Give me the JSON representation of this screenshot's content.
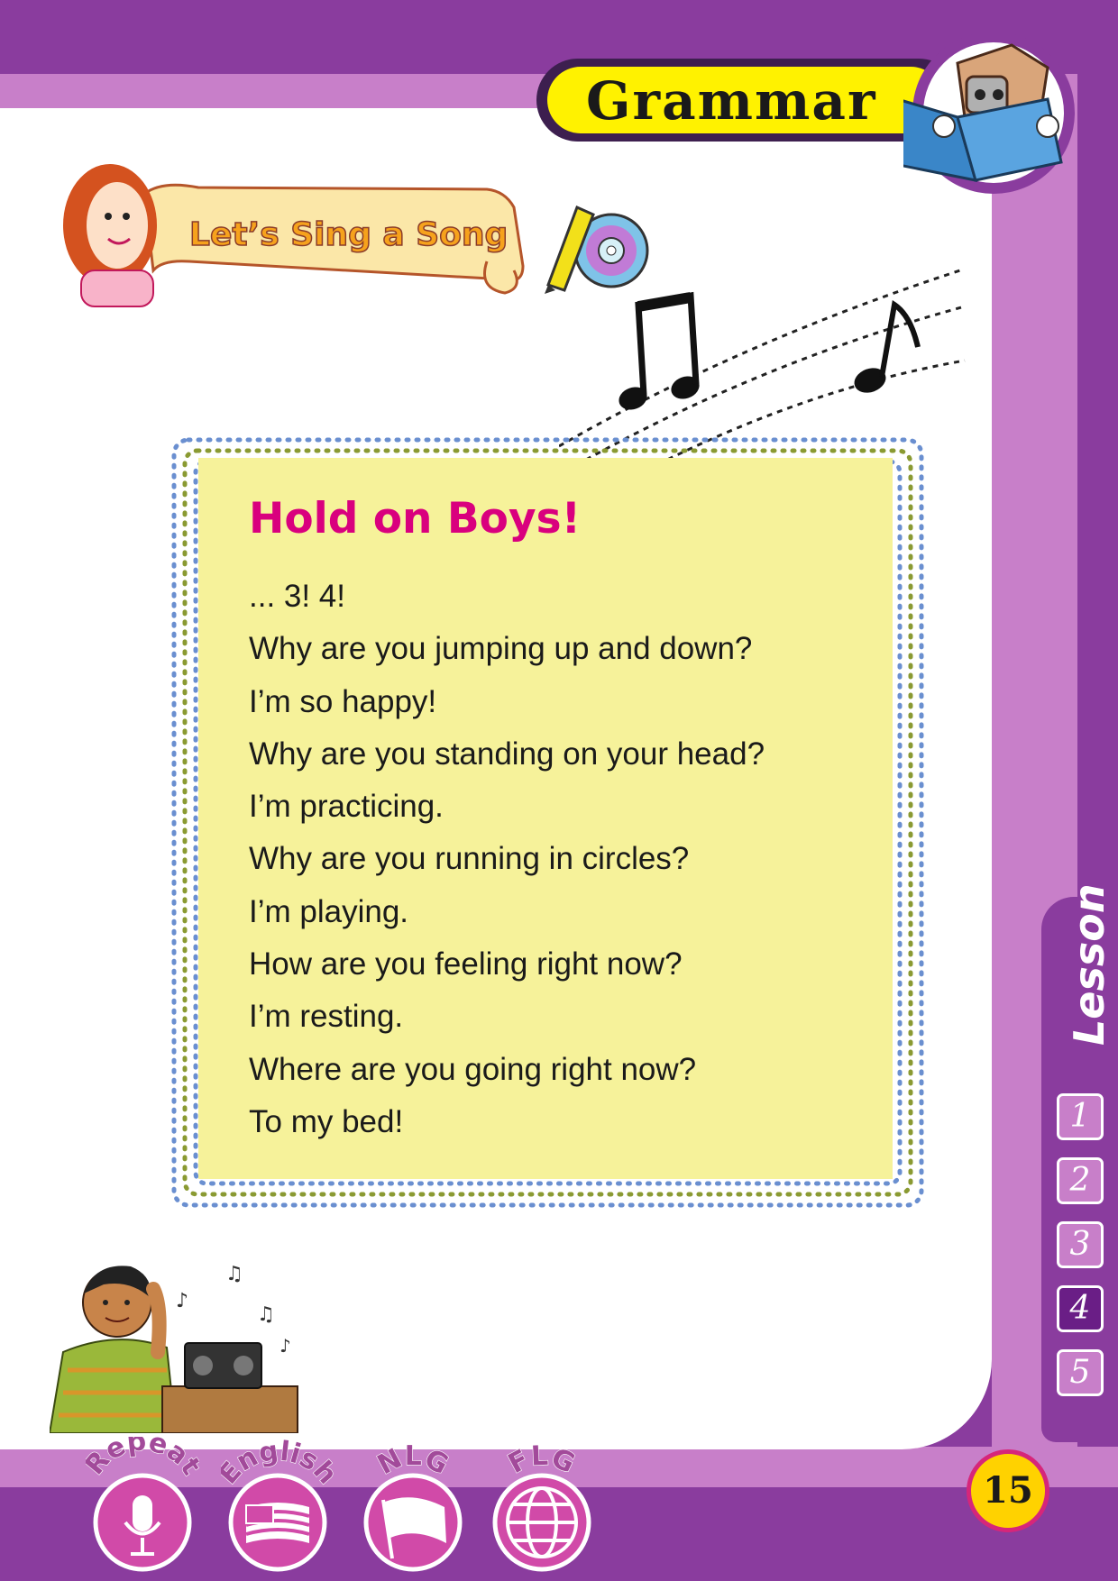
{
  "header": {
    "section_title": "Grammar"
  },
  "banner": {
    "title": "Let’s Sing a Song"
  },
  "song": {
    "title": "Hold on Boys!",
    "lines": [
      "... 3! 4!",
      "Why are you jumping up and down?",
      "I’m so happy!",
      "Why are you standing on your head?",
      "I’m practicing.",
      "Why are you running in circles?",
      "I’m playing.",
      "How are you feeling right now?",
      "I’m resting.",
      "Where are you going right now?",
      "To my bed!"
    ]
  },
  "lesson_tab": {
    "label": "Lesson",
    "numbers": [
      "1",
      "2",
      "3",
      "4",
      "5"
    ],
    "active": "4"
  },
  "footer_badges": [
    {
      "label": "Repeat",
      "icon": "microphone-icon"
    },
    {
      "label": "English",
      "icon": "us-flag-icon"
    },
    {
      "label": "NLG",
      "icon": "flag-icon"
    },
    {
      "label": "FLG",
      "icon": "globe-icon"
    }
  ],
  "page_number": "15",
  "colors": {
    "frame_purple": "#8a3c9e",
    "frame_lilac": "#c87fc9",
    "header_yellow": "#fff200",
    "lyrics_bg": "#f6f29a",
    "song_title": "#d9007e",
    "banner_text": "#f6a21c"
  }
}
